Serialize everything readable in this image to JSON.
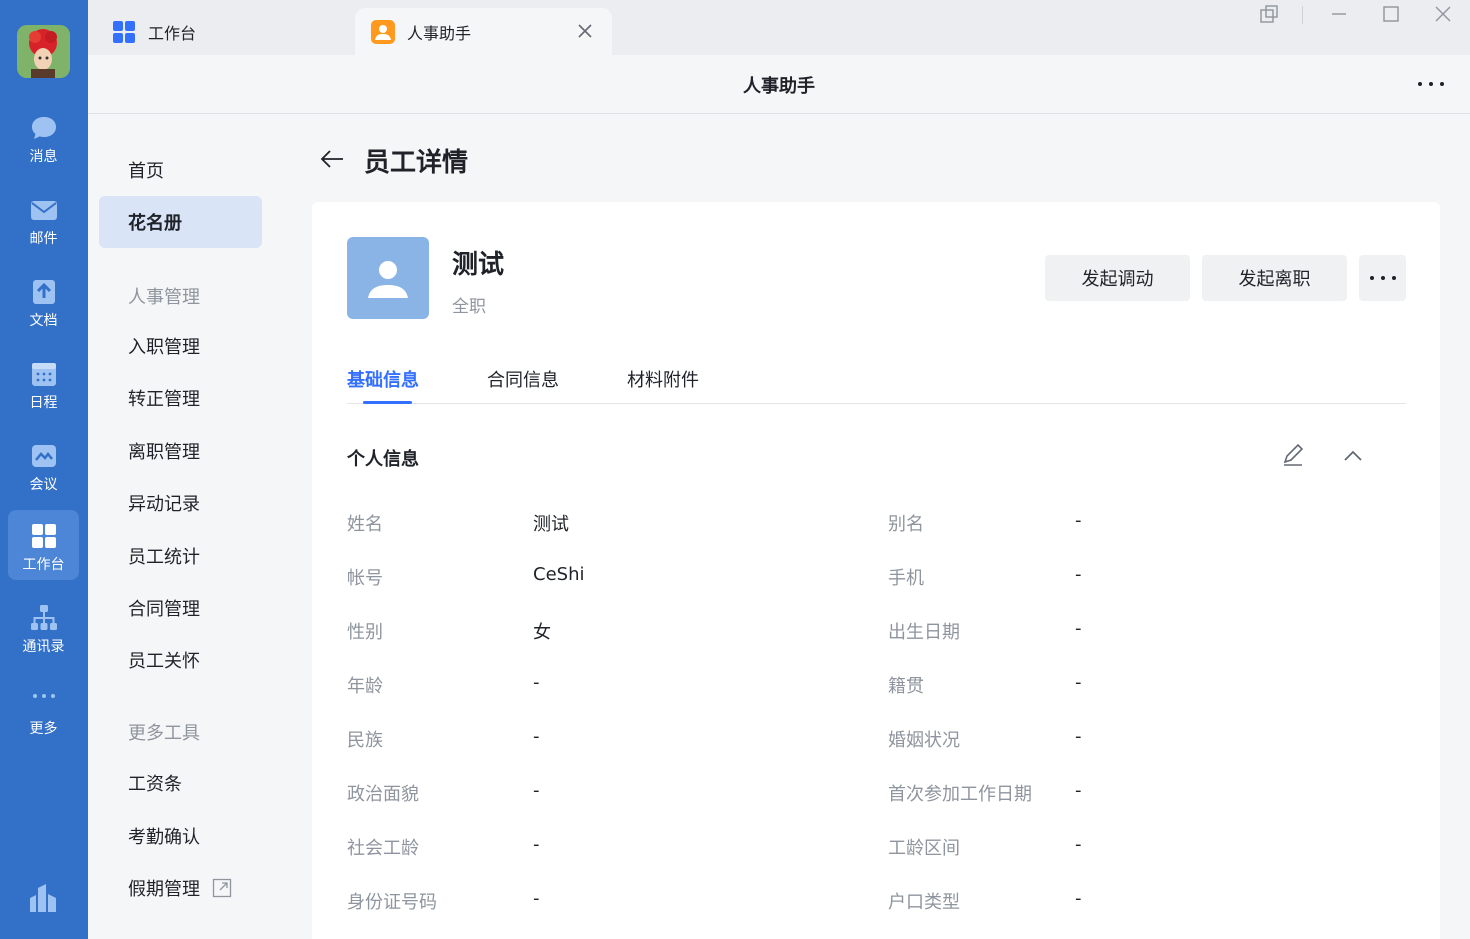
{
  "rail": {
    "items": [
      {
        "label": "消息",
        "icon": "chat-bubble-icon"
      },
      {
        "label": "邮件",
        "icon": "mail-icon"
      },
      {
        "label": "文档",
        "icon": "document-icon"
      },
      {
        "label": "日程",
        "icon": "calendar-icon"
      },
      {
        "label": "会议",
        "icon": "meeting-icon"
      },
      {
        "label": "工作台",
        "icon": "workbench-grid-icon"
      },
      {
        "label": "通讯录",
        "icon": "org-chart-icon"
      },
      {
        "label": "更多",
        "icon": "more-dots-icon"
      }
    ],
    "active": "工作台"
  },
  "tabs": {
    "tab1": {
      "label": "工作台",
      "icon": "grid-icon",
      "color": "#3370ff"
    },
    "tab2": {
      "label": "人事助手",
      "icon": "person-app-icon",
      "color": "#ff9a1f"
    }
  },
  "app": {
    "title": "人事助手"
  },
  "sidenav": {
    "home": "首页",
    "roster": "花名册",
    "group_hr": "人事管理",
    "onboarding": "入职管理",
    "regularization": "转正管理",
    "resignation": "离职管理",
    "changes": "异动记录",
    "stats": "员工统计",
    "contracts": "合同管理",
    "care": "员工关怀",
    "group_tools": "更多工具",
    "payslip": "工资条",
    "attendance": "考勤确认",
    "leave": "假期管理"
  },
  "page": {
    "title": "员工详情"
  },
  "profile": {
    "name": "测试",
    "status": "全职",
    "btn_transfer": "发起调动",
    "btn_resign": "发起离职"
  },
  "content_tabs": [
    "基础信息",
    "合同信息",
    "材料附件"
  ],
  "section": {
    "title": "个人信息"
  },
  "fields_left": [
    {
      "label": "姓名",
      "value": "测试"
    },
    {
      "label": "帐号",
      "value": "CeShi"
    },
    {
      "label": "性别",
      "value": "女"
    },
    {
      "label": "年龄",
      "value": "-"
    },
    {
      "label": "民族",
      "value": "-"
    },
    {
      "label": "政治面貌",
      "value": "-"
    },
    {
      "label": "社会工龄",
      "value": "-"
    },
    {
      "label": "身份证号码",
      "value": "-"
    }
  ],
  "fields_right": [
    {
      "label": "别名",
      "value": "-"
    },
    {
      "label": "手机",
      "value": "-"
    },
    {
      "label": "出生日期",
      "value": "-"
    },
    {
      "label": "籍贯",
      "value": "-"
    },
    {
      "label": "婚姻状况",
      "value": "-"
    },
    {
      "label": "首次参加工作日期",
      "value": "-"
    },
    {
      "label": "工龄区间",
      "value": "-"
    },
    {
      "label": "户口类型",
      "value": "-"
    }
  ],
  "colors": {
    "rail": "#3370c8",
    "accent": "#3370ff",
    "nav_active": "#d9e5f7"
  }
}
